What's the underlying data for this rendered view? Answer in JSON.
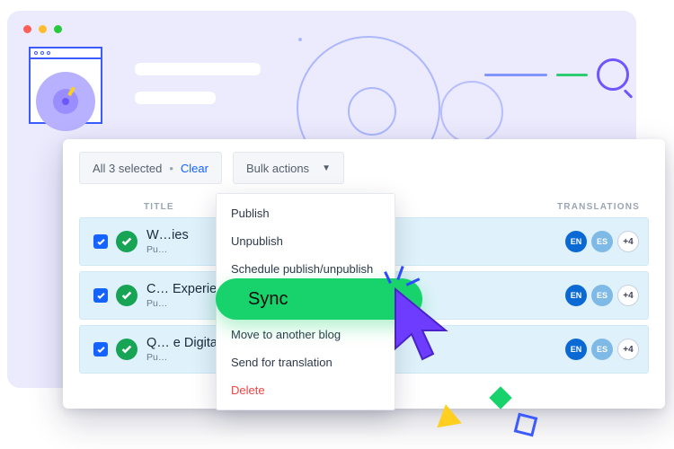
{
  "toolbar": {
    "selection_text": "All 3 selected",
    "clear_label": "Clear",
    "bulk_actions_label": "Bulk actions"
  },
  "headers": {
    "title": "TITLE",
    "translations": "TRANSLATIONS"
  },
  "rows": [
    {
      "title": "W…ies",
      "status_sub": "Pu…"
    },
    {
      "title": "C… Experience",
      "status_sub": "Pu…"
    },
    {
      "title": "Q… e Digital Transformation Era",
      "status_sub": "Pu…"
    }
  ],
  "lang": {
    "en": "EN",
    "es": "ES",
    "more": "+4"
  },
  "menu": {
    "publish": "Publish",
    "unpublish": "Unpublish",
    "schedule": "Schedule publish/unpublish",
    "sync": "Sync",
    "move": "Move to another blog",
    "send": "Send for translation",
    "delete": "Delete"
  }
}
